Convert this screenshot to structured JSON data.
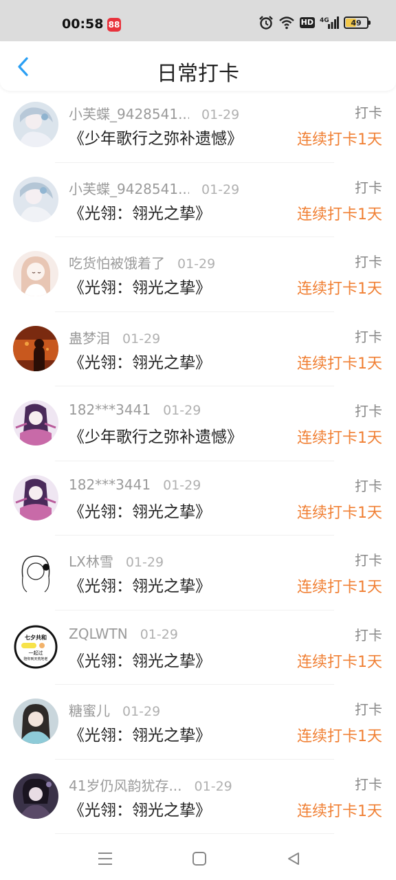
{
  "status_bar": {
    "time": "00:58",
    "app_badge": "88",
    "network": "4G",
    "hd": "HD",
    "battery": "49",
    "battery_level": 0.49
  },
  "header": {
    "title": "日常打卡",
    "back_icon": "chevron-left-icon",
    "accent_color": "#2a9ff4"
  },
  "list": {
    "checkin_label": "打卡",
    "streak_color": "#f07f33",
    "items": [
      {
        "name": "小芙蝶_9428541...",
        "date": "01-29",
        "book": "《少年歌行之弥补遗憾》",
        "checkin": "打卡",
        "streak": "连续打卡1天"
      },
      {
        "name": "小芙蝶_9428541...",
        "date": "01-29",
        "book": "《光翎：翎光之挚》",
        "checkin": "打卡",
        "streak": "连续打卡1天"
      },
      {
        "name": "吃货怕被饿着了",
        "date": "01-29",
        "book": "《光翎：翎光之挚》",
        "checkin": "打卡",
        "streak": "连续打卡1天"
      },
      {
        "name": "蛊梦泪",
        "date": "01-29",
        "book": "《光翎：翎光之挚》",
        "checkin": "打卡",
        "streak": "连续打卡1天"
      },
      {
        "name": "182***3441",
        "date": "01-29",
        "book": "《少年歌行之弥补遗憾》",
        "checkin": "打卡",
        "streak": "连续打卡1天"
      },
      {
        "name": "182***3441",
        "date": "01-29",
        "book": "《光翎：翎光之挚》",
        "checkin": "打卡",
        "streak": "连续打卡1天"
      },
      {
        "name": "LX林雪",
        "date": "01-29",
        "book": "《光翎：翎光之挚》",
        "checkin": "打卡",
        "streak": "连续打卡1天"
      },
      {
        "name": "ZQLWTN",
        "date": "01-29",
        "book": "《光翎：翎光之挚》",
        "checkin": "打卡",
        "streak": "连续打卡1天"
      },
      {
        "name": "糖蜜儿",
        "date": "01-29",
        "book": "《光翎：翎光之挚》",
        "checkin": "打卡",
        "streak": "连续打卡1天"
      },
      {
        "name": "41岁仍风韵犹存...",
        "date": "01-29",
        "book": "《光翎：翎光之挚》",
        "checkin": "打卡",
        "streak": "连续打卡1天"
      }
    ]
  },
  "avatar_text": {
    "line1": "七夕共和",
    "line2": "一起过",
    "line3": "陪你到天荒地老"
  },
  "nav_bar": {
    "menu_icon": "menu-icon",
    "home_icon": "home-square-icon",
    "back_icon": "back-triangle-icon"
  }
}
